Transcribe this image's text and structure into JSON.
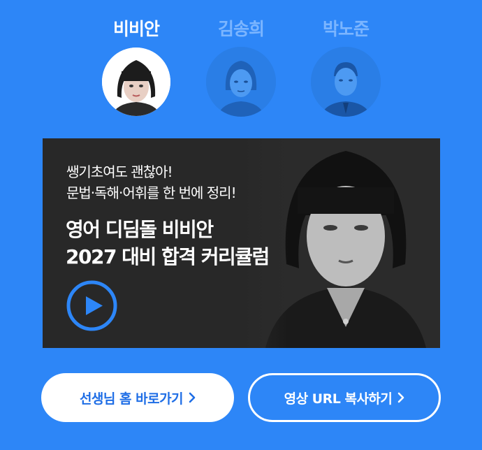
{
  "teachers": [
    {
      "name": "비비안",
      "active": true
    },
    {
      "name": "김송희",
      "active": false
    },
    {
      "name": "박노준",
      "active": false
    }
  ],
  "banner": {
    "subtitle_line1": "쌩기초여도 괜찮아!",
    "subtitle_line2": "문법·독해·어휘를 한 번에 정리!",
    "headline_line1": "영어 디딤돌 비비안",
    "headline_line2": "2027 대비 합격 커리큘럼",
    "play_icon": "play-circle-icon"
  },
  "buttons": {
    "home_label": "선생님 홈 바로가기",
    "copy_label": "영상 URL 복사하기",
    "chevron_icon": "chevron-right-icon"
  },
  "colors": {
    "background": "#2d86f7",
    "banner_bg": "#282828",
    "inactive_tab": "#7bb5ff",
    "primary_text": "#1f6ee6"
  }
}
